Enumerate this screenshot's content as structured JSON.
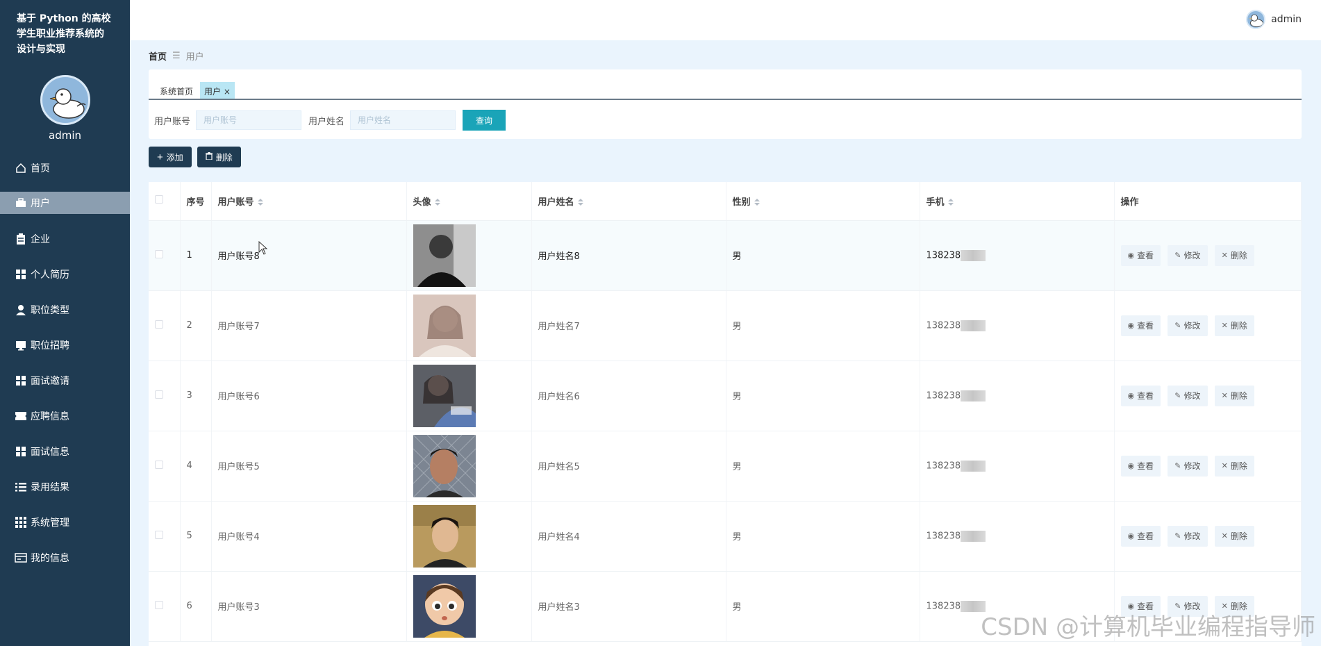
{
  "app": {
    "title": "基于 Python 的高校学生职业推荐系统的设计与实现",
    "title_lines": [
      "基于 Python 的高校",
      "学生职业推荐系统的",
      "设计与实现"
    ]
  },
  "user": {
    "name": "admin"
  },
  "sidebar": {
    "items": [
      {
        "label": "首页",
        "icon": "home-icon"
      },
      {
        "label": "用户",
        "icon": "briefcase-icon",
        "active": true
      },
      {
        "label": "企业",
        "icon": "clipboard-icon"
      },
      {
        "label": "个人简历",
        "icon": "grid-icon"
      },
      {
        "label": "职位类型",
        "icon": "person-icon"
      },
      {
        "label": "职位招聘",
        "icon": "monitor-icon"
      },
      {
        "label": "面试邀请",
        "icon": "grid-icon"
      },
      {
        "label": "应聘信息",
        "icon": "ticket-icon"
      },
      {
        "label": "面试信息",
        "icon": "grid-icon"
      },
      {
        "label": "录用结果",
        "icon": "list-icon"
      },
      {
        "label": "系统管理",
        "icon": "apps-icon"
      },
      {
        "label": "我的信息",
        "icon": "card-icon"
      }
    ]
  },
  "breadcrumb": {
    "home": "首页",
    "current": "用户"
  },
  "tabs": [
    {
      "label": "系统首页"
    },
    {
      "label": "用户",
      "close": "×",
      "active": true
    }
  ],
  "search": {
    "account_label": "用户账号",
    "account_placeholder": "用户账号",
    "name_label": "用户姓名",
    "name_placeholder": "用户姓名",
    "query_label": "查询"
  },
  "toolbar": {
    "add_label": "添加",
    "delete_label": "删除"
  },
  "table": {
    "headers": [
      "序号",
      "用户账号",
      "头像",
      "用户姓名",
      "性别",
      "手机",
      "操作"
    ],
    "rows": [
      {
        "index": "1",
        "account": "用户账号8",
        "name": "用户姓名8",
        "gender": "男",
        "phone": "138238"
      },
      {
        "index": "2",
        "account": "用户账号7",
        "name": "用户姓名7",
        "gender": "男",
        "phone": "138238"
      },
      {
        "index": "3",
        "account": "用户账号6",
        "name": "用户姓名6",
        "gender": "男",
        "phone": "138238"
      },
      {
        "index": "4",
        "account": "用户账号5",
        "name": "用户姓名5",
        "gender": "男",
        "phone": "138238"
      },
      {
        "index": "5",
        "account": "用户账号4",
        "name": "用户姓名4",
        "gender": "男",
        "phone": "138238"
      },
      {
        "index": "6",
        "account": "用户账号3",
        "name": "用户姓名3",
        "gender": "男",
        "phone": "138238"
      }
    ],
    "ops": {
      "view": "查看",
      "edit": "修改",
      "delete": "删除"
    }
  },
  "watermark": "CSDN @计算机毕业编程指导师",
  "colors": {
    "sidebar": "#1f3b52",
    "accent": "#1aa4b8",
    "active_tab": "#b9e6f4",
    "page_bg": "#eaf4fd"
  }
}
